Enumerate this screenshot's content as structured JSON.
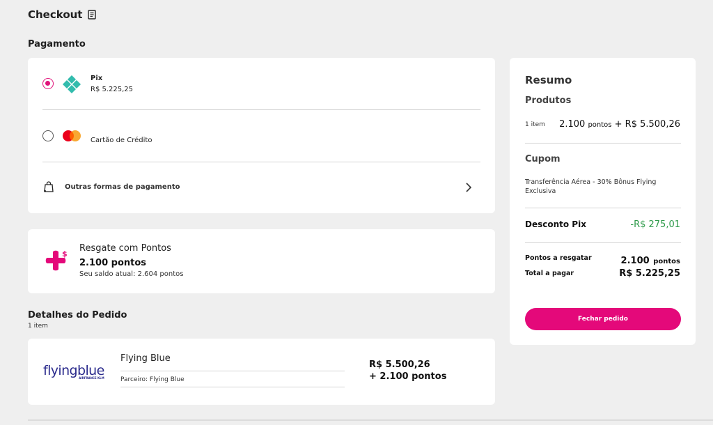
{
  "header": {
    "title": "Checkout"
  },
  "payment": {
    "section_title": "Pagamento",
    "pix": {
      "label": "Pix",
      "value": "R$ 5.225,25"
    },
    "credit": {
      "label": "Cartão de Crédito"
    },
    "other": {
      "label": "Outras formas de pagamento"
    }
  },
  "points": {
    "title": "Resgate com Pontos",
    "amount": "2.100 pontos",
    "balance": "Seu saldo atual: 2.604 pontos"
  },
  "details": {
    "section_title": "Detalhes do Pedido",
    "count": "1 item",
    "product": {
      "logo_text": "flyingblue",
      "logo_sub": "AIRFRANCE KLM",
      "name": "Flying Blue",
      "partner": "Parceiro: Flying Blue",
      "price": "R$ 5.500,26",
      "points": "+ 2.100 pontos"
    }
  },
  "summary": {
    "title": "Resumo",
    "products_title": "Produtos",
    "items": "1 item",
    "points_num": "2.100",
    "points_word": "pontos",
    "plus_price": "+ R$ 5.500,26",
    "coupon_title": "Cupom",
    "coupon_text": "Transferência Aérea - 30% Bônus Flying Exclusiva",
    "discount_label": "Desconto Pix",
    "discount_value": "-R$ 275,01",
    "redeem_label": "Pontos a resgatar",
    "redeem_num": "2.100",
    "redeem_word": "pontos",
    "total_label": "Total a pagar",
    "total_value": "R$ 5.225,25",
    "button": "Fechar pedido"
  },
  "colors": {
    "accent": "#e4097a",
    "pix": "#32bcad",
    "discount": "#2e9a4a",
    "brand_blue": "#2a2a8c"
  }
}
